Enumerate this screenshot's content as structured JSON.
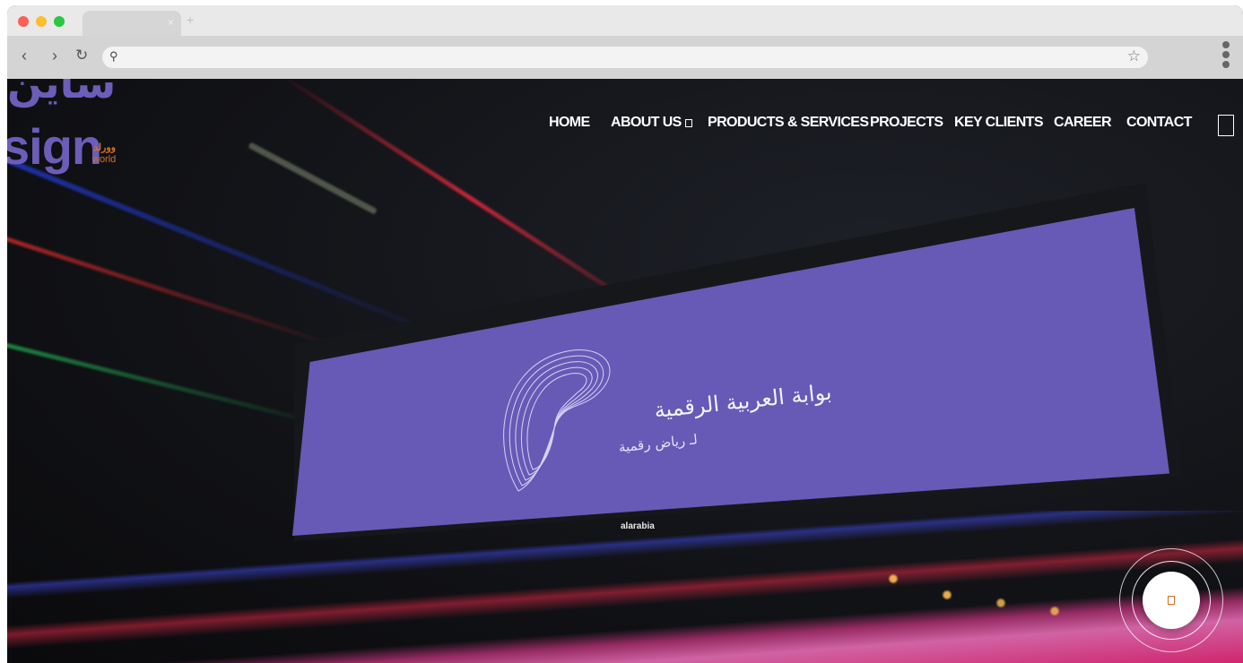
{
  "browser": {
    "tab_close": "×",
    "new_tab": "+",
    "back": "‹",
    "forward": "›",
    "reload": "↻",
    "search_icon": "⚲",
    "bookmark_icon": "☆"
  },
  "site": {
    "logo": {
      "arabic_text": "ساين",
      "english_text": "sign",
      "sub_arabic": "وورلد",
      "sub_english": "world"
    },
    "nav": {
      "items": [
        {
          "label": "HOME"
        },
        {
          "label": "ABOUT US",
          "has_dropdown": true
        },
        {
          "label": "PRODUCTS & SERVICES"
        },
        {
          "label": "PROJECTS"
        },
        {
          "label": "KEY CLIENTS"
        },
        {
          "label": "CAREER"
        },
        {
          "label": "CONTACT"
        }
      ]
    },
    "hero": {
      "billboard_title": "بوابة العربية الرقمية",
      "billboard_subtitle": "لـ رياض رقمية",
      "billboard_brand": "alarabia"
    }
  },
  "colors": {
    "brand_purple": "#6c5db8",
    "brand_orange": "#d4702b",
    "billboard": "#665ab6"
  },
  "icons": {
    "menu": "hamburger-icon",
    "chat": "chat-icon"
  }
}
